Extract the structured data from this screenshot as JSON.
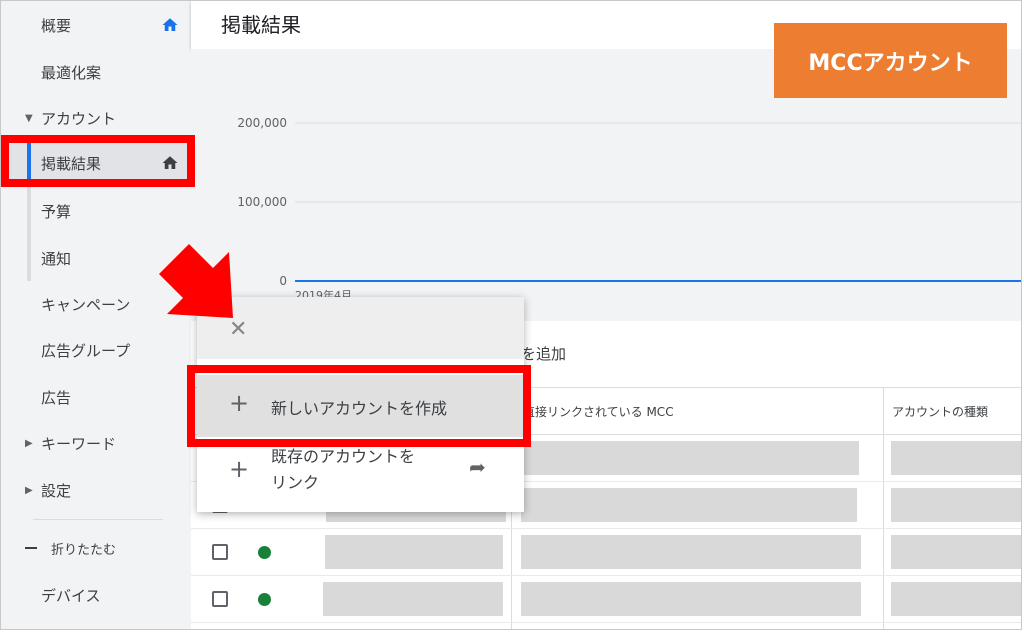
{
  "sidebar": {
    "items": {
      "overview": "概要",
      "recommendations": "最適化案",
      "accounts": "アカウント",
      "performance": "掲載結果",
      "budget": "予算",
      "notifications": "通知",
      "campaigns": "キャンペーン",
      "adgroups": "広告グループ",
      "ads": "広告",
      "keywords": "キーワード",
      "settings": "設定",
      "collapse": "折りたたむ",
      "devices": "デバイス"
    }
  },
  "header": {
    "title": "掲載結果"
  },
  "chart": {
    "x_label_partial": "2019年4月"
  },
  "chart_data": {
    "type": "line",
    "title": "",
    "xlabel": "",
    "ylabel": "",
    "yticks": [
      "200,000",
      "100,000",
      "0"
    ],
    "ylim": [
      0,
      200000
    ],
    "x": [
      "2019年4月"
    ],
    "series": [
      {
        "values": [
          0,
          0
        ]
      }
    ],
    "grid": true
  },
  "table": {
    "add_text_partial": "を追加",
    "headers": {
      "direct_mcc": "直接リンクされている MCC",
      "account_type": "アカウントの種類"
    }
  },
  "popup": {
    "close": "✕",
    "create_new": "新しいアカウントを作成",
    "link_existing_line1": "既存のアカウントを",
    "link_existing_line2": "リンク",
    "plus": "+",
    "share": "➦"
  },
  "annotation": {
    "badge": "MCCアカウント"
  },
  "colors": {
    "badge": "#ed7d31",
    "highlight": "#ff0000",
    "status_dot": "#188038",
    "chart_line": "#1a73e8"
  }
}
